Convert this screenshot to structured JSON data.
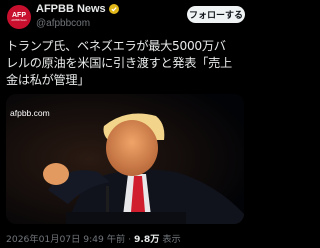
{
  "account": {
    "name": "AFPBB News",
    "handle": "@afpbbcom",
    "logo_text": "AFP",
    "logo_subtext": "AFPBB News",
    "verified_color": "#e2b719",
    "follow_label": "フォローする"
  },
  "post": {
    "lines": [
      "トランプ氏、ベネズエラが最大5000万バ",
      "レルの原油を米国に引き渡すと発表「売上",
      "金は私が管理」"
    ],
    "media_watermark": "afpbb.com"
  },
  "meta": {
    "timestamp": "2026年01月07日 9:49 午前",
    "separator": "·",
    "views_count": "9.8万",
    "views_label": "表示"
  },
  "icons": {
    "verified": "verified-badge-icon",
    "more": "more-options-icon"
  },
  "colors": {
    "background": "#000000",
    "brand_red": "#c8102e",
    "text_primary": "#e7e9ea",
    "text_secondary": "#71767b"
  }
}
